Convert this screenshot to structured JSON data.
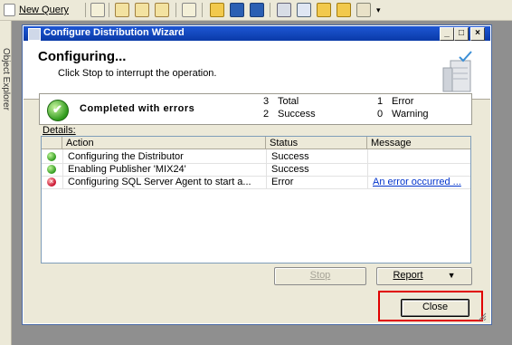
{
  "host": {
    "toolbar": {
      "new_query_label": "New Query"
    },
    "object_explorer_label": "Object Explorer"
  },
  "dialog": {
    "title": "Configure Distribution Wizard",
    "title_buttons": {
      "minimize": "_",
      "maximize": "□",
      "close": "×"
    },
    "header": {
      "title": "Configuring...",
      "subtitle": "Click Stop to interrupt the operation."
    },
    "summary": {
      "status": "Completed with errors",
      "total_count": "3",
      "total_label": "Total",
      "success_count": "2",
      "success_label": "Success",
      "error_count": "1",
      "error_label": "Error",
      "warning_count": "0",
      "warning_label": "Warning"
    },
    "details_label": "Details:",
    "grid": {
      "columns": [
        "Action",
        "Status",
        "Message"
      ],
      "rows": [
        {
          "icon": "success-icon",
          "action": "Configuring the Distributor",
          "status": "Success",
          "message": ""
        },
        {
          "icon": "success-icon",
          "action": "Enabling Publisher 'MIX24'",
          "status": "Success",
          "message": ""
        },
        {
          "icon": "error-icon",
          "action": "Configuring SQL Server Agent to start a...",
          "status": "Error",
          "message": "An error occurred ..."
        }
      ]
    },
    "buttons": {
      "stop": "Stop",
      "report": "Report",
      "report_arrow": "▼",
      "close": "Close"
    }
  },
  "colors": {
    "title_bar": "#0a3aa8",
    "highlight": "#e00000",
    "success": "#2f9a1c",
    "error": "#c8102e"
  }
}
